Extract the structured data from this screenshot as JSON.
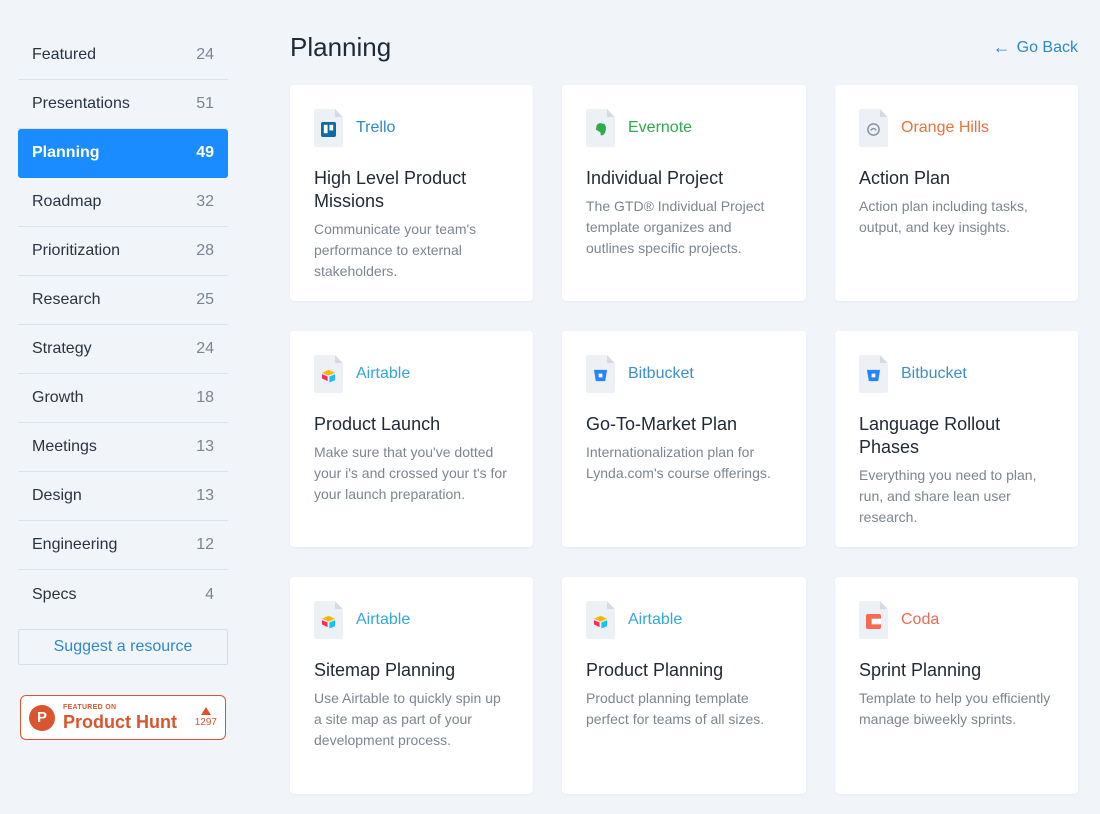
{
  "sidebar": {
    "items": [
      {
        "label": "Featured",
        "count": "24"
      },
      {
        "label": "Presentations",
        "count": "51"
      },
      {
        "label": "Planning",
        "count": "49"
      },
      {
        "label": "Roadmap",
        "count": "32"
      },
      {
        "label": "Prioritization",
        "count": "28"
      },
      {
        "label": "Research",
        "count": "25"
      },
      {
        "label": "Strategy",
        "count": "24"
      },
      {
        "label": "Growth",
        "count": "18"
      },
      {
        "label": "Meetings",
        "count": "13"
      },
      {
        "label": "Design",
        "count": "13"
      },
      {
        "label": "Engineering",
        "count": "12"
      },
      {
        "label": "Specs",
        "count": "4"
      }
    ],
    "active_index": 2,
    "suggest_label": "Suggest a resource",
    "product_hunt": {
      "small": "FEATURED ON",
      "big": "Product Hunt",
      "votes": "1297",
      "logo_letter": "P"
    }
  },
  "header": {
    "title": "Planning",
    "go_back": "Go Back"
  },
  "colors": {
    "accent": "#1a8cff",
    "trello": "#2f88c8",
    "evernote": "#2eab4a",
    "orange_hills": "#e8733a",
    "airtable": "#35a7d6",
    "bitbucket": "#3b8fd0",
    "coda": "#e86a57",
    "product_hunt": "#da552f"
  },
  "cards": [
    {
      "brand": "Trello",
      "brand_color": "#2f88c8",
      "icon": "trello-icon",
      "title": "High Level Product Missions",
      "desc": "Communicate your team's performance to external stakeholders."
    },
    {
      "brand": "Evernote",
      "brand_color": "#2eab4a",
      "icon": "evernote-icon",
      "title": "Individual Project",
      "desc": "The GTD® Individual Project template organizes and outlines specific projects."
    },
    {
      "brand": "Orange Hills",
      "brand_color": "#e8733a",
      "icon": "orange-hills-icon",
      "title": "Action Plan",
      "desc": "Action plan including tasks, output, and key insights."
    },
    {
      "brand": "Airtable",
      "brand_color": "#35a7d6",
      "icon": "airtable-icon",
      "title": "Product Launch",
      "desc": "Make sure that you've dotted your i's and crossed your t's for your launch preparation."
    },
    {
      "brand": "Bitbucket",
      "brand_color": "#3b8fd0",
      "icon": "bitbucket-icon",
      "title": "Go-To-Market Plan",
      "desc": "Internationalization plan for Lynda.com's course offerings."
    },
    {
      "brand": "Bitbucket",
      "brand_color": "#3b8fd0",
      "icon": "bitbucket-icon",
      "title": "Language Rollout Phases",
      "desc": "Everything you need to plan, run, and share lean user research."
    },
    {
      "brand": "Airtable",
      "brand_color": "#35a7d6",
      "icon": "airtable-icon",
      "title": "Sitemap Planning",
      "desc": "Use Airtable to quickly spin up a site map as part of your development process."
    },
    {
      "brand": "Airtable",
      "brand_color": "#35a7d6",
      "icon": "airtable-icon",
      "title": "Product Planning",
      "desc": "Product planning template perfect for teams of all sizes."
    },
    {
      "brand": "Coda",
      "brand_color": "#e86a57",
      "icon": "coda-icon",
      "title": "Sprint Planning",
      "desc": "Template to help you efficiently manage biweekly sprints."
    }
  ]
}
